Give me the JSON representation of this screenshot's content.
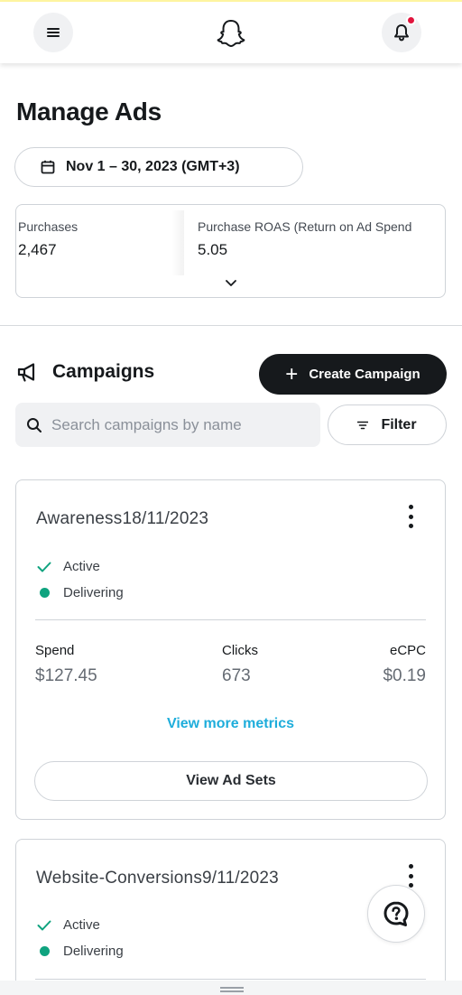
{
  "app": {
    "name": "Snapchat Ads Manager",
    "colors": {
      "accent_blue": "#1eaddb",
      "status_green": "#0fa37f",
      "notification_red": "#e1143d",
      "dark": "#16191c"
    }
  },
  "header": {
    "menu_icon": "hamburger-icon",
    "logo_icon": "snapchat-ghost-icon",
    "bell_icon": "bell-icon",
    "has_notification": true
  },
  "page": {
    "title": "Manage Ads"
  },
  "date_range": {
    "icon": "calendar-icon",
    "label": "Nov 1 – 30, 2023 (GMT+3)"
  },
  "metrics": [
    {
      "label": "Purchases",
      "value": "2,467"
    },
    {
      "label": "Purchase ROAS (Return on Ad Spend",
      "value": "5.05"
    }
  ],
  "campaigns": {
    "icon": "megaphone-icon",
    "title": "Campaigns",
    "create_label": "Create Campaign",
    "search_placeholder": "Search campaigns by name",
    "search_value": "",
    "filter_label": "Filter",
    "list": [
      {
        "name": "Awareness18/11/2023",
        "status": "Active",
        "delivery": "Delivering",
        "stats": [
          {
            "label": "Spend",
            "value": "$127.45"
          },
          {
            "label": "Clicks",
            "value": "673"
          },
          {
            "label": "eCPC",
            "value": "$0.19"
          }
        ],
        "view_more_label": "View more metrics",
        "view_adsets_label": "View Ad Sets"
      },
      {
        "name": "Website-Conversions9/11/2023",
        "status": "Active",
        "delivery": "Delivering"
      }
    ]
  },
  "help": {
    "icon": "help-question-icon"
  }
}
